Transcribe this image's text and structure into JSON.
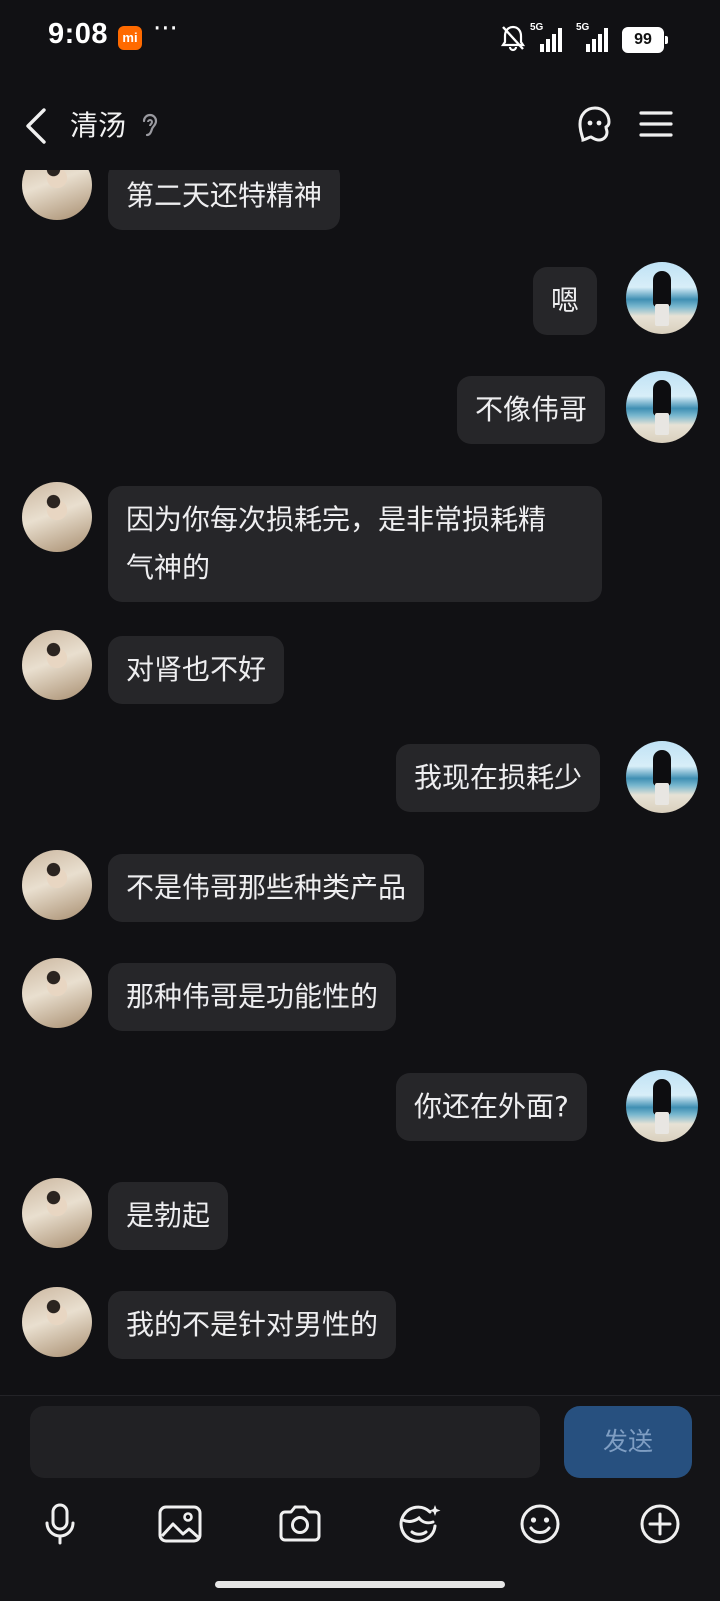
{
  "status_bar": {
    "time": "9:08",
    "carrier_badge": "mi",
    "more": "···",
    "net1": "5G",
    "net2": "5G",
    "battery": "99"
  },
  "header": {
    "title": "清汤",
    "icons": [
      "back-icon",
      "ear-icon",
      "ghost-icon",
      "menu-icon"
    ]
  },
  "messages": [
    {
      "side": "left",
      "text": "第二天还特精神"
    },
    {
      "side": "right",
      "text": "嗯"
    },
    {
      "side": "right",
      "text": "不像伟哥"
    },
    {
      "side": "left",
      "text": "因为你每次损耗完，是非常损耗精\n气神的"
    },
    {
      "side": "left",
      "text": "对肾也不好"
    },
    {
      "side": "right",
      "text": "我现在损耗少"
    },
    {
      "side": "left",
      "text": "不是伟哥那些种类产品"
    },
    {
      "side": "left",
      "text": "那种伟哥是功能性的"
    },
    {
      "side": "right",
      "text": "你还在外面?"
    },
    {
      "side": "left",
      "text": "是勃起"
    },
    {
      "side": "left",
      "text": "我的不是针对男性的"
    }
  ],
  "composer": {
    "input_value": "",
    "send_label": "发送"
  },
  "toolbar": [
    "microphone-icon",
    "image-icon",
    "camera-icon",
    "emoji-sticker-icon",
    "smiley-icon",
    "plus-icon"
  ],
  "colors": {
    "background": "#111114",
    "bubble": "#262629",
    "send_button": "#27507f"
  }
}
